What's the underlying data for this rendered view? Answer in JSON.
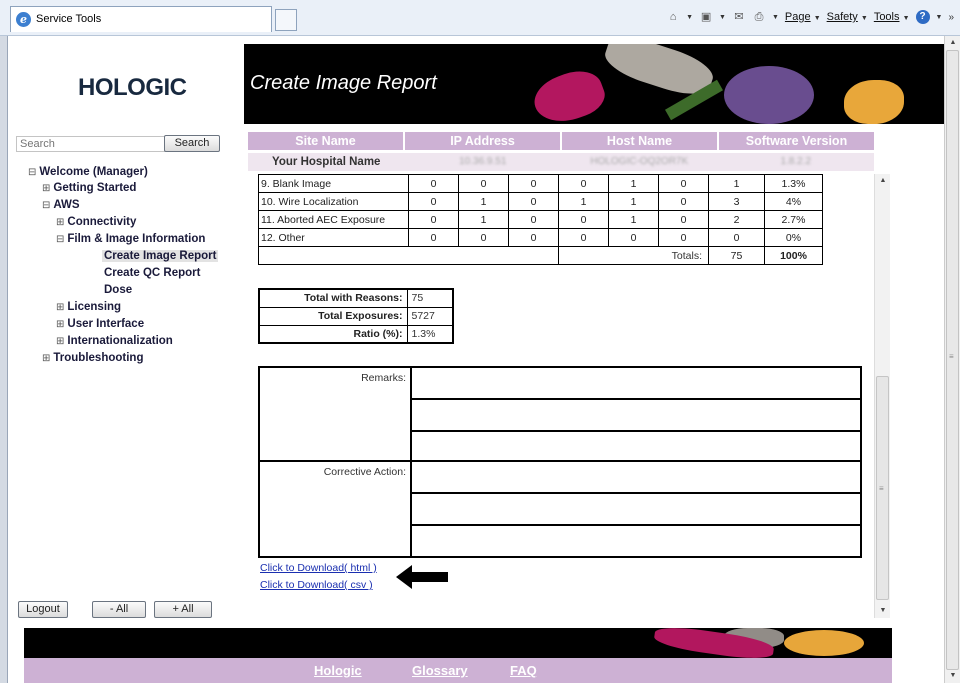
{
  "browser": {
    "tab_title": "Service Tools",
    "page_menu": "Page",
    "safety_menu": "Safety",
    "tools_menu": "Tools",
    "overflow": "»"
  },
  "header": {
    "logo": "HOLOGIC",
    "title": "Create Image Report"
  },
  "sidebar": {
    "search_placeholder": "Search",
    "search_button": "Search",
    "tree": {
      "welcome": "Welcome (Manager)",
      "getting_started": "Getting Started",
      "aws": "AWS",
      "connectivity": "Connectivity",
      "film_image": "Film & Image Information",
      "create_image_report": "Create Image Report",
      "create_qc_report": "Create QC Report",
      "dose": "Dose",
      "licensing": "Licensing",
      "user_interface": "User Interface",
      "internationalization": "Internationalization",
      "troubleshooting": "Troubleshooting"
    },
    "logout_button": "Logout",
    "minus_all_button": "- All",
    "plus_all_button": "+ All"
  },
  "site_info": {
    "headers": [
      "Site Name",
      "IP Address",
      "Host Name",
      "Software Version"
    ],
    "hospital": "Your Hospital Name",
    "ip": "10.36.9.51",
    "host": "HOLOGIC-OQ2OR7K",
    "version": "1.8.2.2"
  },
  "reasons": [
    {
      "label": "9. Blank Image",
      "c": [
        "0",
        "0",
        "0",
        "0",
        "1",
        "0"
      ],
      "total": "1",
      "pct": "1.3%"
    },
    {
      "label": "10. Wire Localization",
      "c": [
        "0",
        "1",
        "0",
        "1",
        "1",
        "0"
      ],
      "total": "3",
      "pct": "4%"
    },
    {
      "label": "11. Aborted AEC Exposure",
      "c": [
        "0",
        "1",
        "0",
        "0",
        "1",
        "0"
      ],
      "total": "2",
      "pct": "2.7%"
    },
    {
      "label": "12. Other",
      "c": [
        "0",
        "0",
        "0",
        "0",
        "0",
        "0"
      ],
      "total": "0",
      "pct": "0%"
    }
  ],
  "totals_row": {
    "label": "Totals:",
    "total": "75",
    "pct": "100%"
  },
  "summary": {
    "with_reasons_label": "Total with Reasons:",
    "with_reasons": "75",
    "exposures_label": "Total Exposures:",
    "exposures": "5727",
    "ratio_label": "Ratio (%):",
    "ratio": "1.3%"
  },
  "remarks": {
    "remarks_label": "Remarks:",
    "corrective_label": "Corrective Action:"
  },
  "downloads": {
    "html": "Click to Download( html )",
    "csv": "Click to Download( csv )"
  },
  "footer": {
    "hologic": "Hologic",
    "glossary": "Glossary",
    "faq": "FAQ"
  }
}
